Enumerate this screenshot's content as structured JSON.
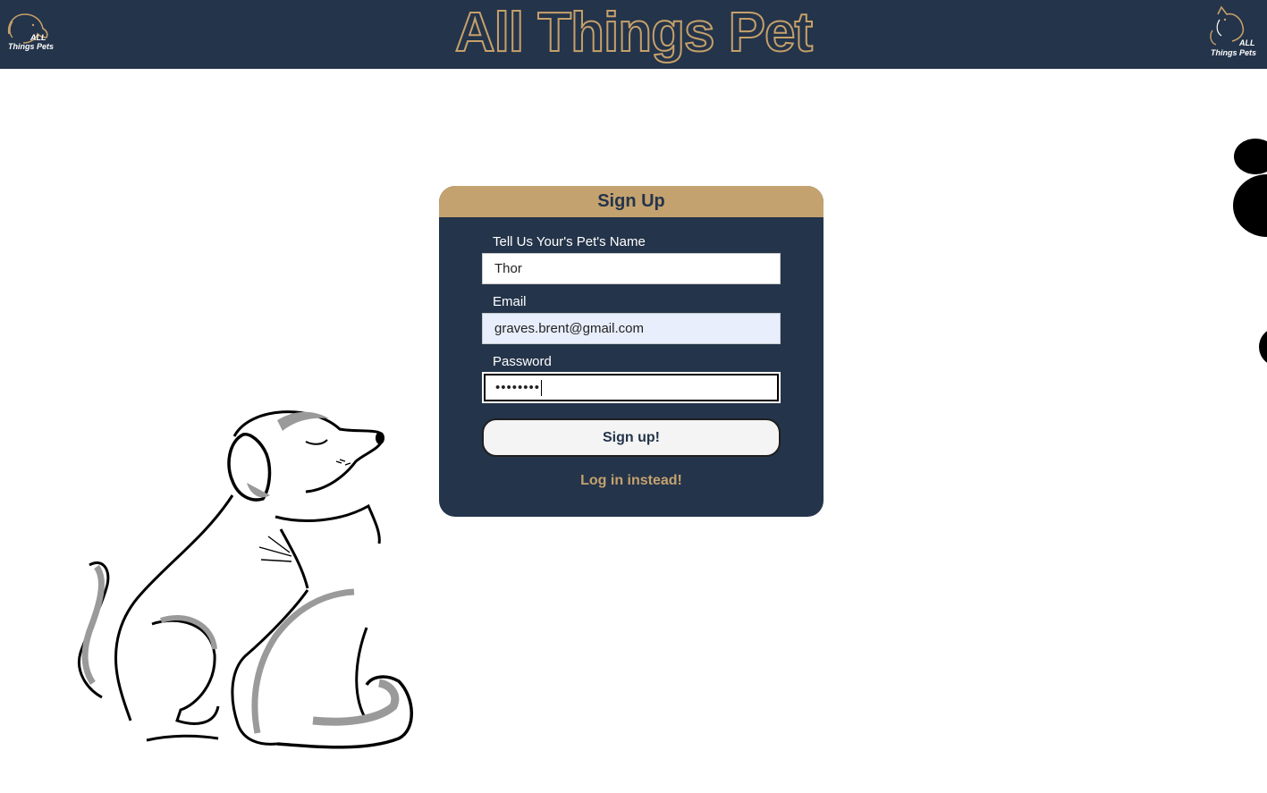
{
  "header": {
    "title": "All Things Pet",
    "logo_left": {
      "line1": "ALL",
      "line2": "Things Pets"
    },
    "logo_right": {
      "line1": "ALL",
      "line2": "Things Pets"
    }
  },
  "signup": {
    "heading": "Sign Up",
    "pet_name_label": "Tell Us Your's Pet's Name",
    "pet_name_value": "Thor",
    "email_label": "Email",
    "email_value": "graves.brent@gmail.com",
    "password_label": "Password",
    "password_value": "••••••••",
    "submit_label": "Sign up!",
    "alt_link": "Log in instead!"
  },
  "colors": {
    "navy": "#24344a",
    "gold": "#c4a26f",
    "autofill": "#e8eefb"
  },
  "icons": [
    "dog-logo-icon",
    "cat-logo-icon",
    "dog-cat-illustration",
    "paw-print-icon"
  ]
}
